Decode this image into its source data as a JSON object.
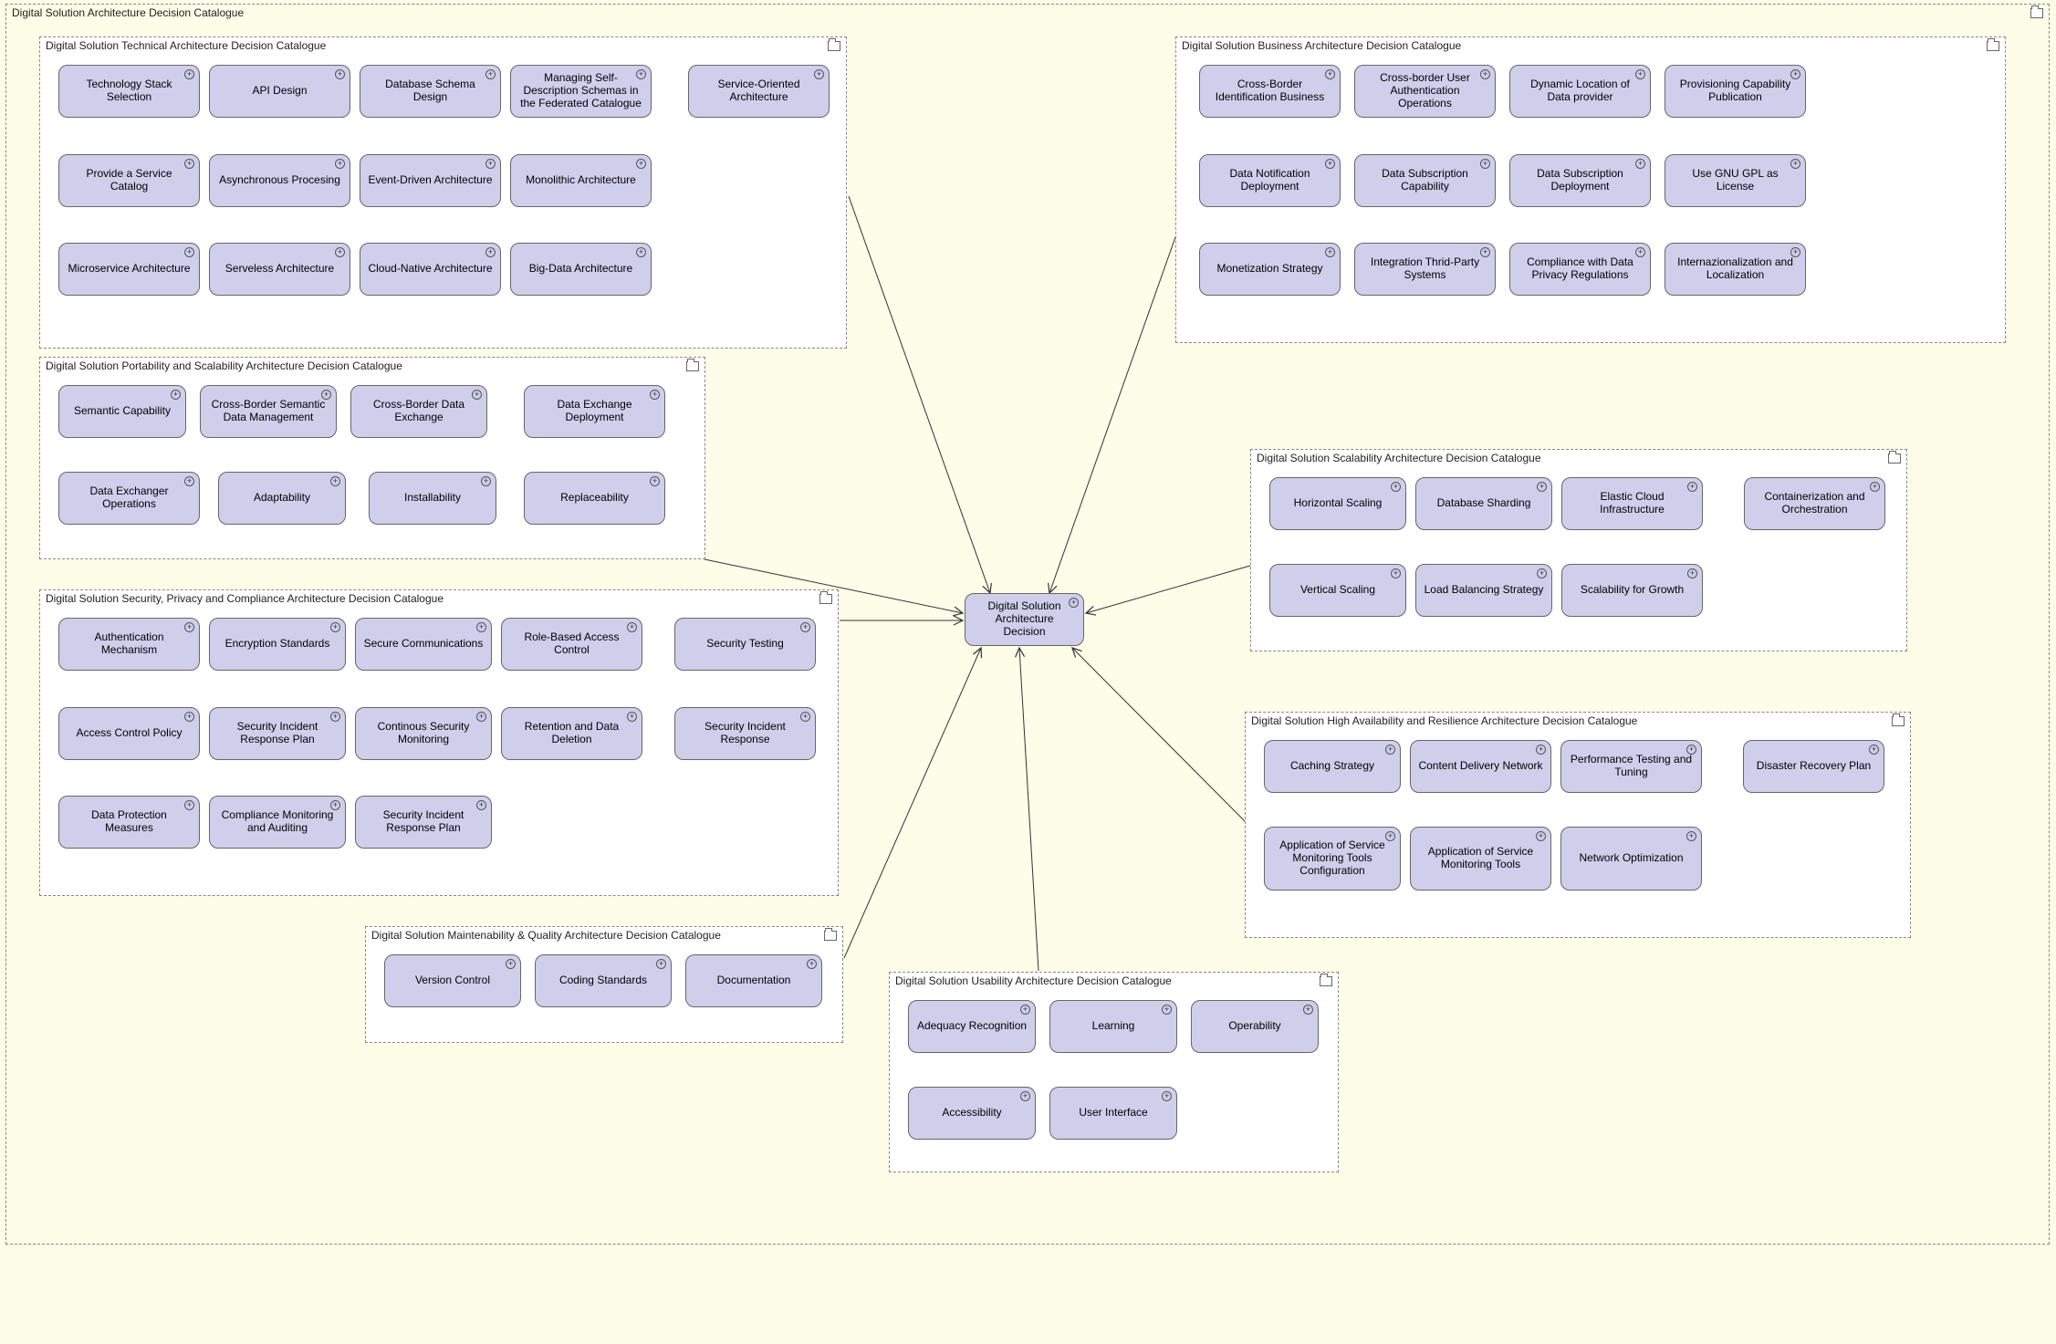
{
  "outer": {
    "title": "Digital Solution Architecture Decision Catalogue"
  },
  "center": {
    "label": "Digital Solution Architecture Decision"
  },
  "packages": {
    "technical": {
      "title": "Digital Solution Technical Architecture Decision Catalogue",
      "n1": "Technology Stack Selection",
      "n2": "API Design",
      "n3": "Database Schema Design",
      "n4": "Managing Self-Description Schemas in the Federated Catalogue",
      "n5": "Service-Oriented Architecture",
      "n6": "Provide a Service Catalog",
      "n7": "Asynchronous Procesing",
      "n8": "Event-Driven Architecture",
      "n9": "Monolithic Architecture",
      "n10": "Microservice Architecture",
      "n11": "Serveless Architecture",
      "n12": "Cloud-Native Architecture",
      "n13": "Big-Data Architecture"
    },
    "portability": {
      "title": "Digital Solution Portability and Scalability Architecture Decision Catalogue",
      "n1": "Semantic Capability",
      "n2": "Cross-Border Semantic Data Management",
      "n3": "Cross-Border Data Exchange",
      "n4": "Data Exchange Deployment",
      "n5": "Data Exchanger Operations",
      "n6": "Adaptability",
      "n7": "Installability",
      "n8": "Replaceability"
    },
    "security": {
      "title": "Digital Solution Security, Privacy and Compliance Architecture Decision Catalogue",
      "n1": "Authentication Mechanism",
      "n2": "Encryption Standards",
      "n3": "Secure Communications",
      "n4": "Role-Based Access Control",
      "n5": "Security Testing",
      "n6": "Access Control Policy",
      "n7": "Security Incident Response Plan",
      "n8": "Continous Security Monitoring",
      "n9": "Retention and Data Deletion",
      "n10": "Security Incident Response",
      "n11": "Data Protection Measures",
      "n12": "Compliance Monitoring and Auditing",
      "n13": "Security Incident Response Plan"
    },
    "maintain": {
      "title": "Digital Solution Maintenability & Quality Architecture Decision Catalogue",
      "n1": "Version Control",
      "n2": "Coding Standards",
      "n3": "Documentation"
    },
    "usability": {
      "title": "Digital Solution Usability Architecture Decision Catalogue",
      "n1": "Adequacy Recognition",
      "n2": "Learning",
      "n3": "Operability",
      "n4": "Accessibility",
      "n5": "User Interface"
    },
    "business": {
      "title": "Digital Solution Business Architecture Decision Catalogue",
      "n1": "Cross-Border Identification Business",
      "n2": "Cross-border User Authentication Operations",
      "n3": "Dynamic Location of Data provider",
      "n4": "Provisioning Capability Publication",
      "n5": "Data Notification Deployment",
      "n6": "Data Subscription Capability",
      "n7": "Data Subscription Deployment",
      "n8": "Use GNU GPL as License",
      "n9": "Monetization Strategy",
      "n10": "Integration Thrid-Party Systems",
      "n11": "Compliance with Data Privacy Regulations",
      "n12": "Internazionalization and Localization"
    },
    "scalability": {
      "title": "Digital Solution Scalability Architecture Decision Catalogue",
      "n1": "Horizontal Scaling",
      "n2": "Database Sharding",
      "n3": "Elastic Cloud Infrastructure",
      "n4": "Containerization and Orchestration",
      "n5": "Vertical Scaling",
      "n6": "Load Balancing Strategy",
      "n7": "Scalability for Growth"
    },
    "highavail": {
      "title": "Digital Solution High Availability and Resilience Architecture Decision Catalogue",
      "n1": "Caching Strategy",
      "n2": "Content Delivery Network",
      "n3": "Performance Testing and Tuning",
      "n4": "Disaster Recovery Plan",
      "n5": "Application of Service Monitoring Tools Configuration",
      "n6": "Application of Service Monitoring Tools",
      "n7": "Network Optimization"
    }
  }
}
